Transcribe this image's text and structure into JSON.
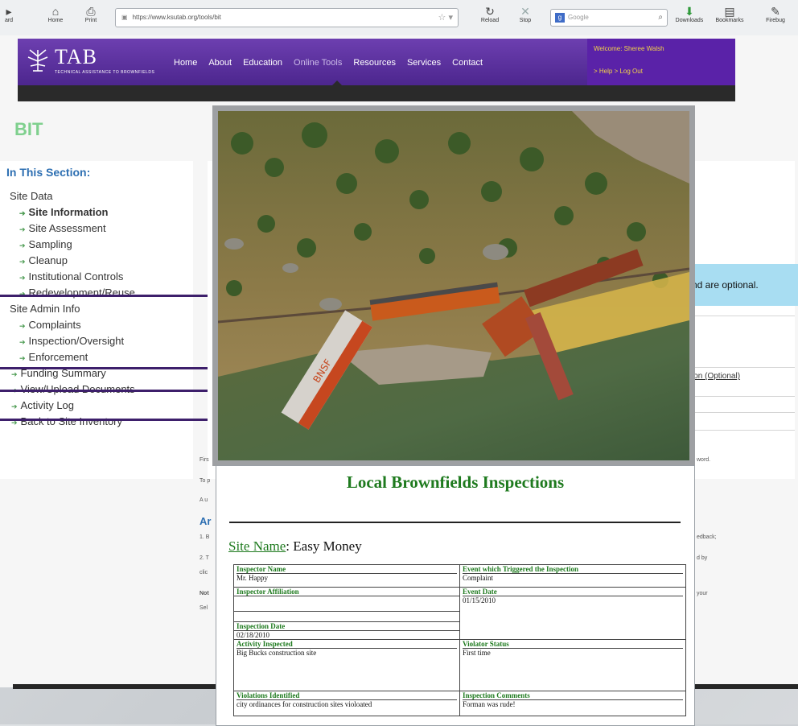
{
  "browser": {
    "back_label": "ard",
    "home_label": "Home",
    "print_label": "Print",
    "url": "https://www.ksutab.org/tools/bit",
    "url_domain": "ksutab.org",
    "reload_label": "Reload",
    "stop_label": "Stop",
    "search_placeholder": "Google",
    "downloads_label": "Downloads",
    "bookmarks_label": "Bookmarks",
    "firebug_label": "Firebug"
  },
  "header": {
    "logo_text": "TAB",
    "logo_subtitle": "TECHNICAL ASSISTANCE TO BROWNFIELDS",
    "nav": [
      "Home",
      "About",
      "Education",
      "Online Tools",
      "Resources",
      "Services",
      "Contact"
    ],
    "active_nav": "Online Tools",
    "welcome": "Welcome: Sheree Walsh",
    "links": "> Help  > Log Out"
  },
  "page": {
    "title": "BIT",
    "note_text": "nd are optional.",
    "optional_link": "ion (Optional)",
    "lower": {
      "line1": "Firs",
      "line2": "To p",
      "line3": "A u",
      "heading": "Ar",
      "line4": "1. B",
      "line5": "2. T",
      "line6": "clic",
      "line7": "Not",
      "line8": "Sel",
      "right1": "word.",
      "right2": "edback;",
      "right3": "d by",
      "right4": "your"
    }
  },
  "sidebar": {
    "title": "In This Section:",
    "items": [
      {
        "label": "Site Data",
        "arrow": false,
        "bold": false
      },
      {
        "label": "Site Information",
        "arrow": true,
        "bold": true
      },
      {
        "label": "Site Assessment",
        "arrow": true,
        "bold": false
      },
      {
        "label": "Sampling",
        "arrow": true,
        "bold": false
      },
      {
        "label": "Cleanup",
        "arrow": true,
        "bold": false
      },
      {
        "label": "Institutional Controls",
        "arrow": true,
        "bold": false
      },
      {
        "label": "Redevelopment/Reuse",
        "arrow": true,
        "bold": false
      },
      {
        "label": "Site Admin Info",
        "arrow": false,
        "bold": false
      },
      {
        "label": "Complaints",
        "arrow": true,
        "bold": false
      },
      {
        "label": "Inspection/Oversight",
        "arrow": true,
        "bold": false
      },
      {
        "label": "Enforcement",
        "arrow": true,
        "bold": false
      },
      {
        "label": "Funding Summary",
        "arrow": true,
        "bold": false
      },
      {
        "label": "View/Upload Documents",
        "arrow": true,
        "bold": false
      },
      {
        "label": "Activity Log",
        "arrow": true,
        "bold": false
      },
      {
        "label": "Back to Site Inventory",
        "arrow": true,
        "bold": false
      }
    ]
  },
  "photo": {
    "locomotive_text": "BNSF"
  },
  "report": {
    "title": "Local Brownfields Inspections",
    "site_label": "Site Name",
    "site_value": ": Easy Money",
    "fields": {
      "inspector_name": {
        "label": "Inspector Name",
        "value": "Mr. Happy"
      },
      "event_trigger": {
        "label": "Event which Triggered the Inspection",
        "value": "Complaint"
      },
      "inspector_affiliation": {
        "label": "Inspector Affiliation",
        "value": ""
      },
      "event_date": {
        "label": "Event Date",
        "value": "01/15/2010"
      },
      "inspection_date": {
        "label": "Inspection Date",
        "value": "02/18/2010"
      },
      "activity_inspected": {
        "label": "Activity Inspected",
        "value": "Big Bucks construction site"
      },
      "violator_status": {
        "label": "Violator Status",
        "value": "First time"
      },
      "violations_identified": {
        "label": "Violations Identified",
        "value": "city ordinances for construction sites violoated"
      },
      "inspection_comments": {
        "label": "Inspection Comments",
        "value": "Forman was rude!"
      }
    }
  },
  "colors": {
    "header_purple": "#5a2aa0",
    "title_green": "#7fd08e",
    "report_green": "#1e7a1e",
    "sidebar_blue": "#2d6fb2",
    "highlight_box": "#3d1f6b"
  }
}
